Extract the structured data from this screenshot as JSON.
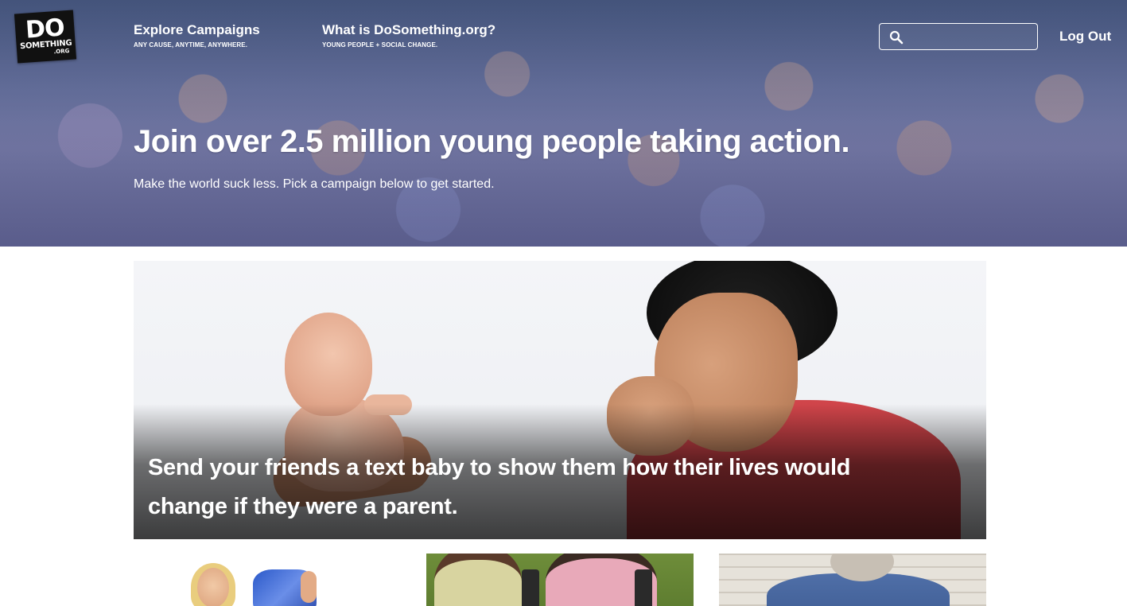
{
  "header": {
    "logo": {
      "line1": "DO",
      "line2": "SOMETHING",
      "line3": ".ORG"
    },
    "nav": [
      {
        "title": "Explore Campaigns",
        "subtitle": "ANY CAUSE, ANYTIME, ANYWHERE."
      },
      {
        "title": "What is DoSomething.org?",
        "subtitle": "YOUNG PEOPLE + SOCIAL CHANGE."
      }
    ],
    "search": {
      "value": "",
      "placeholder": "",
      "icon": "search-icon"
    },
    "logout_label": "Log Out"
  },
  "hero": {
    "headline": "Join over 2.5 million young people taking action.",
    "subheadline": "Make the world suck less. Pick a campaign below to get started."
  },
  "featured_campaign": {
    "caption": "Send your friends a text baby to show them how their lives would change if they were a parent."
  },
  "campaign_cards": [
    {
      "image": "woman-with-fabric"
    },
    {
      "image": "kids-with-backpacks"
    },
    {
      "image": "person-sitting-by-brick-wall"
    }
  ],
  "colors": {
    "hero_tint": "#5b6a9a",
    "text_on_dark": "#ffffff",
    "featured_shirt": "#c9404a"
  }
}
